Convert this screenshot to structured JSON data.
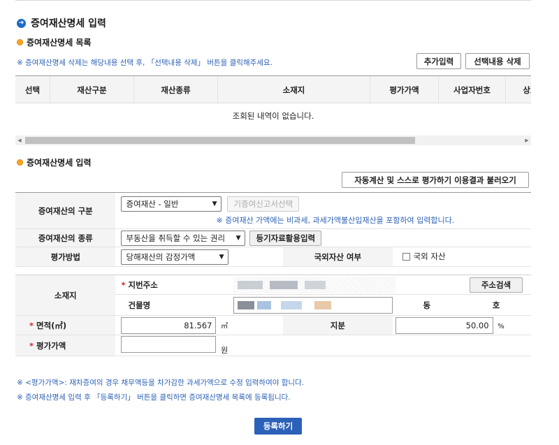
{
  "header": {
    "title": "증여재산명세 입력"
  },
  "list_section": {
    "subtitle": "증여재산명세 목록",
    "notice": "※ 증여재산명세 삭제는 해당내용 선택 후, 「선택내용 삭제」 버튼을 클릭해주세요.",
    "add_button": "추가입력",
    "delete_button": "선택내용 삭제",
    "columns": [
      "선택",
      "재산구분",
      "재산종류",
      "소재지",
      "평가가액",
      "사업자번호",
      "상호"
    ],
    "empty_message": "조회된 내역이 없습니다."
  },
  "input_section": {
    "subtitle": "증여재산명세 입력",
    "load_button": "자동계산 및 스스로 평가하기 이용결과 불러오기",
    "category": {
      "label": "증여재산의 구분",
      "selected": "증여재산 - 일반",
      "select_button": "기증여신고서선택",
      "hint": "※ 증여재산 가액에는 비과세, 과세가액불산입재산을 포함하여 입력합니다."
    },
    "type": {
      "label": "증여재산의 종류",
      "selected": "부동산을 취득할 수 있는 권리",
      "registry_button": "등기자료활용입력"
    },
    "valuation": {
      "label": "평가방법",
      "selected": "당해재산의 감정가액",
      "foreign_label": "국외자산 여부",
      "foreign_checkbox": "국외 자산"
    },
    "location": {
      "label": "소재지",
      "address_label": "지번주소",
      "address_search_button": "주소검색",
      "building_label": "건물명",
      "dong_label": "동",
      "ho_label": "호"
    },
    "area": {
      "label": "면적(㎡)",
      "value": "81.567",
      "unit": "㎡",
      "share_label": "지분",
      "share_value": "50.00",
      "share_unit": "%"
    },
    "value": {
      "label": "평가가액",
      "value": "",
      "unit": "원"
    }
  },
  "footnotes": [
    "※ <평가가액>: 재차증여의 경우 채무액등을 차가감한 과세가액으로 수정 입력하여야 합니다.",
    "※ 증여재산명세 입력 후 「등록하기」 버튼을 클릭하면 증여재산명세 목록에 등록됩니다."
  ],
  "submit_button": "등록하기",
  "colors": {
    "accent": "#2b61b8",
    "required": "#d9252b",
    "notice": "#2d62b5"
  }
}
